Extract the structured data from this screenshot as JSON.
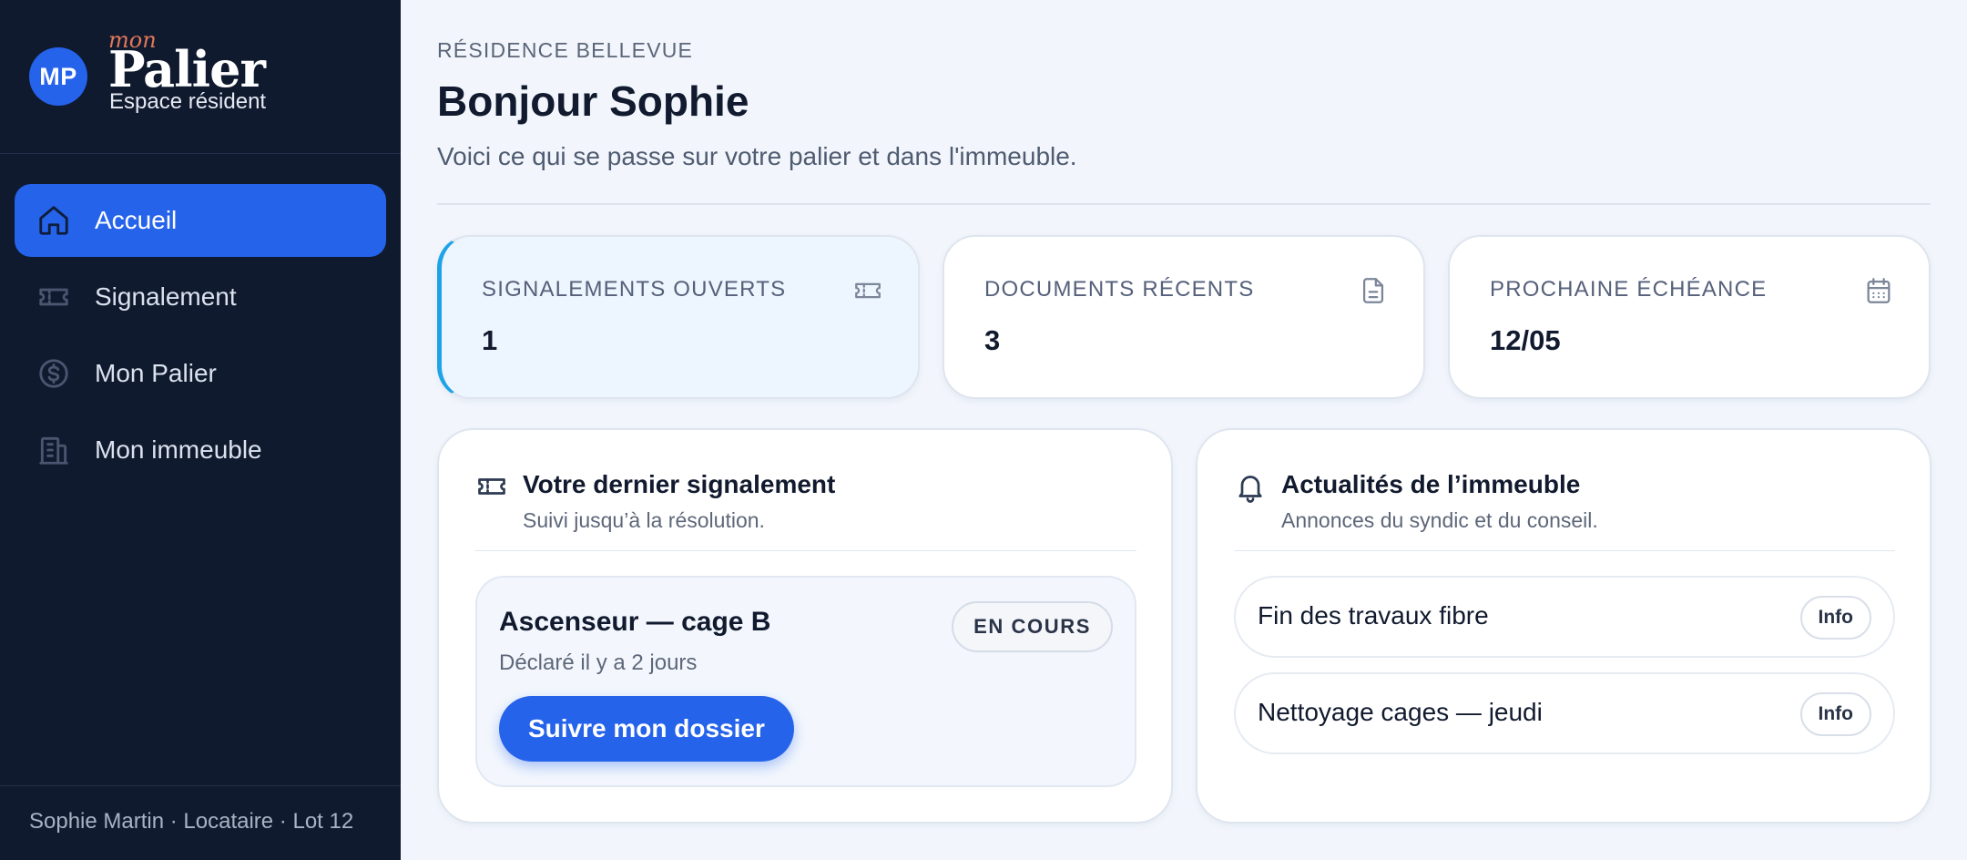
{
  "brand": {
    "initials": "MP",
    "prefix": "mon",
    "name": "Palier",
    "subtitle": "Espace résident"
  },
  "sidebar": {
    "items": [
      {
        "label": "Accueil",
        "icon": "home-icon",
        "active": true
      },
      {
        "label": "Signalement",
        "icon": "ticket-icon",
        "active": false
      },
      {
        "label": "Mon Palier",
        "icon": "dollar-circle-icon",
        "active": false
      },
      {
        "label": "Mon immeuble",
        "icon": "building-icon",
        "active": false
      }
    ],
    "footer": "Sophie Martin · Locataire · Lot 12"
  },
  "header": {
    "eyebrow": "RÉSIDENCE BELLEVUE",
    "title": "Bonjour Sophie",
    "subtitle": "Voici ce qui se passe sur votre palier et dans l'immeuble."
  },
  "stats": [
    {
      "label": "SIGNALEMENTS OUVERTS",
      "value": "1",
      "icon": "ticket-icon"
    },
    {
      "label": "DOCUMENTS RÉCENTS",
      "value": "3",
      "icon": "document-icon"
    },
    {
      "label": "PROCHAINE ÉCHÉANCE",
      "value": "12/05",
      "icon": "calendar-icon"
    }
  ],
  "last_report": {
    "title": "Votre dernier signalement",
    "subtitle": "Suivi jusqu’à la résolution.",
    "ticket": {
      "title": "Ascenseur — cage B",
      "meta": "Déclaré il y a 2 jours",
      "status": "EN COURS",
      "action": "Suivre mon dossier"
    }
  },
  "news": {
    "title": "Actualités de l’immeuble",
    "subtitle": "Annonces du syndic et du conseil.",
    "items": [
      {
        "text": "Fin des travaux fibre",
        "tag": "Info"
      },
      {
        "text": "Nettoyage cages — jeudi",
        "tag": "Info"
      }
    ]
  },
  "colors": {
    "sidebar_bg": "#101a2e",
    "accent": "#2563eb",
    "highlight_border": "#1fa3e8",
    "brand_prefix": "#e2775a",
    "page_bg": "#f2f6fc"
  }
}
